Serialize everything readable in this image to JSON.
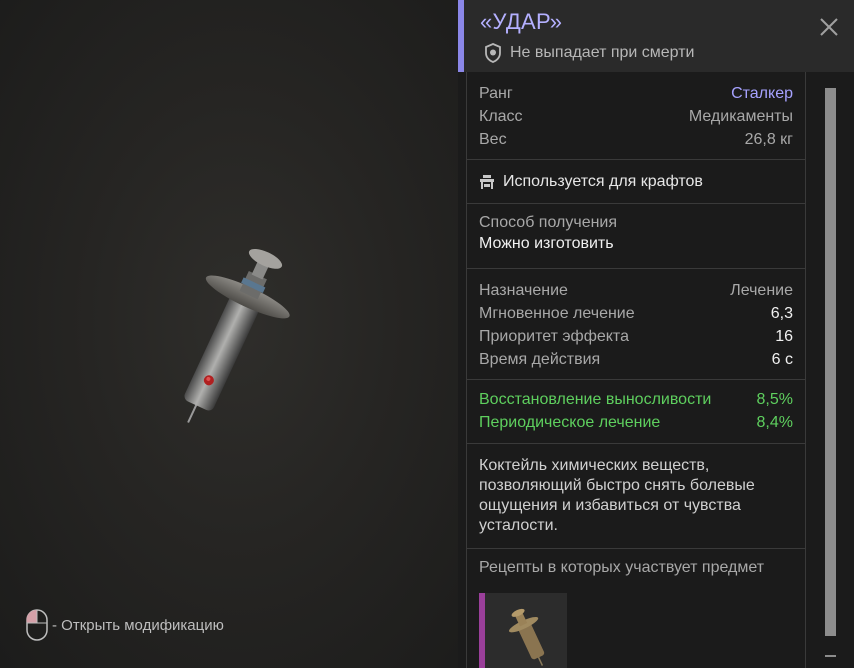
{
  "item": {
    "title": "«УДАР»",
    "no_drop_text": "Не выпадает при смерти",
    "accent_color": "#8b87e8"
  },
  "viewer": {
    "hint_text": "- Открыть модификацию"
  },
  "stats": [
    {
      "label": "Ранг",
      "value": "Сталкер"
    },
    {
      "label": "Класс",
      "value": "Медикаменты"
    },
    {
      "label": "Вес",
      "value": "26,8 кг"
    }
  ],
  "craft": {
    "text": "Используется для крафтов"
  },
  "obtain": {
    "label": "Способ получения",
    "value": "Можно изготовить"
  },
  "effects": [
    {
      "label": "Назначение",
      "value": "Лечение"
    },
    {
      "label": "Мгновенное лечение",
      "value": "6,3"
    },
    {
      "label": "Приоритет эффекта",
      "value": "16"
    },
    {
      "label": "Время действия",
      "value": "6 с"
    }
  ],
  "bonuses": [
    {
      "label": "Восстановление выносливости",
      "value": "8,5%"
    },
    {
      "label": "Периодическое лечение",
      "value": "8,4%"
    }
  ],
  "description": "Коктейль химических веществ, позволяющий быстро снять болевые ощущения и избавиться от чувства усталости.",
  "recipes": {
    "label": "Рецепты в которых участвует предмет",
    "item_border_color": "#9a3f9a"
  },
  "icons": {
    "shield": "shield-icon",
    "close": "close-icon",
    "craft": "workbench-icon",
    "mouse": "mouse-icon"
  }
}
